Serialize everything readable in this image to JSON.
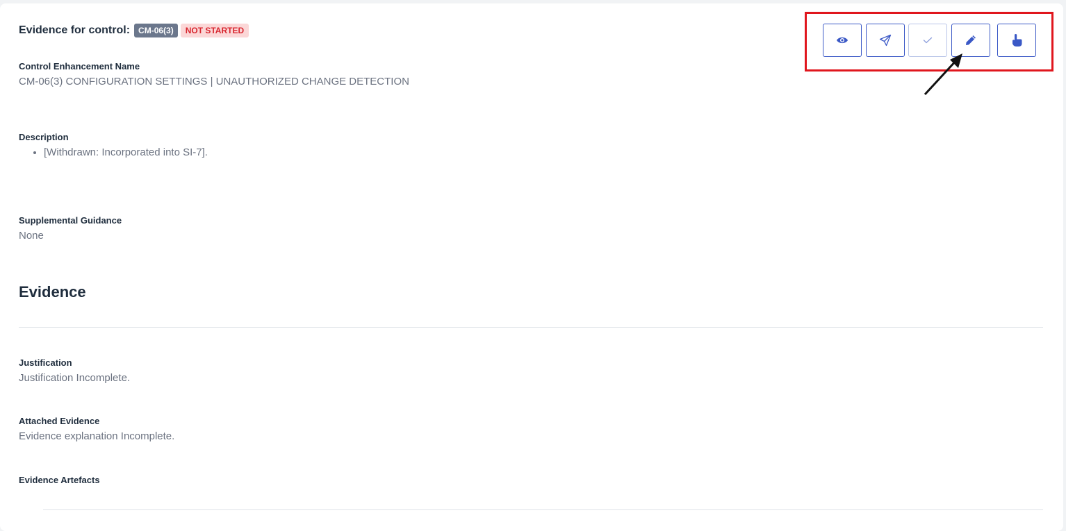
{
  "header": {
    "title": "Evidence for control:",
    "control_id": "CM-06(3)",
    "status": "NOT STARTED"
  },
  "fields": {
    "enhancement_name": {
      "label": "Control Enhancement Name",
      "value": "CM-06(3) CONFIGURATION SETTINGS | UNAUTHORIZED CHANGE DETECTION"
    },
    "description": {
      "label": "Description",
      "items": [
        "[Withdrawn: Incorporated into SI-7]."
      ]
    },
    "supplemental_guidance": {
      "label": "Supplemental Guidance",
      "value": "None"
    }
  },
  "evidence": {
    "section_title": "Evidence",
    "justification": {
      "label": "Justification",
      "value": "Justification Incomplete."
    },
    "attached_evidence": {
      "label": "Attached Evidence",
      "value": "Evidence explanation Incomplete."
    },
    "artefacts": {
      "label": "Evidence Artefacts"
    }
  },
  "toolbar": {
    "buttons": [
      {
        "icon": "eye-icon",
        "enabled": true
      },
      {
        "icon": "send-icon",
        "enabled": true
      },
      {
        "icon": "check-icon",
        "enabled": false
      },
      {
        "icon": "pencil-icon",
        "enabled": true
      },
      {
        "icon": "hand-pointer-icon",
        "enabled": true
      }
    ]
  },
  "colors": {
    "accent": "#3a58c6",
    "highlight": "#e0161d",
    "badge_gray": "#6b778c",
    "status_bg": "#fbd7d7",
    "status_text": "#d8262f"
  }
}
